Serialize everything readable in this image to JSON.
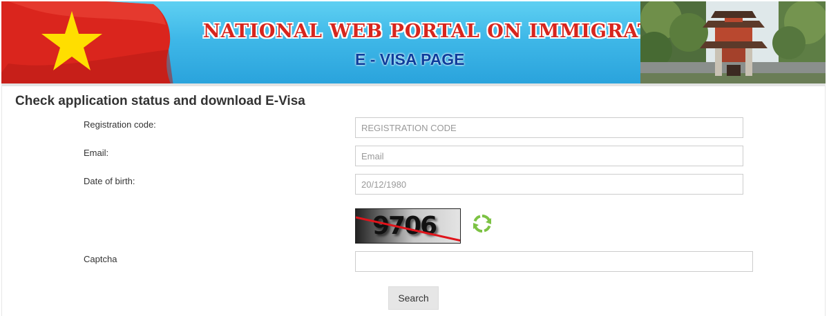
{
  "banner": {
    "title": "NATIONAL WEB PORTAL ON IMMIGRATION",
    "subtitle": "E - VISA PAGE",
    "flag_colors": {
      "red": "#da251d",
      "star": "#ffde00"
    }
  },
  "form": {
    "heading": "Check application status and download E-Visa",
    "registration_code": {
      "label": "Registration code:",
      "placeholder": "REGISTRATION CODE",
      "value": ""
    },
    "email": {
      "label": "Email:",
      "placeholder": "Email",
      "value": ""
    },
    "date_of_birth": {
      "label": "Date of birth:",
      "placeholder": "20/12/1980",
      "value": ""
    },
    "captcha": {
      "label": "Captcha",
      "image_text": "9706",
      "value": "",
      "refresh_icon": "refresh-icon"
    },
    "search_button": "Search"
  },
  "colors": {
    "banner_blue": "#3fb8e8",
    "title_red": "#d7261e",
    "subtitle_blue": "#0d3d9c",
    "refresh_green": "#7cc243"
  }
}
